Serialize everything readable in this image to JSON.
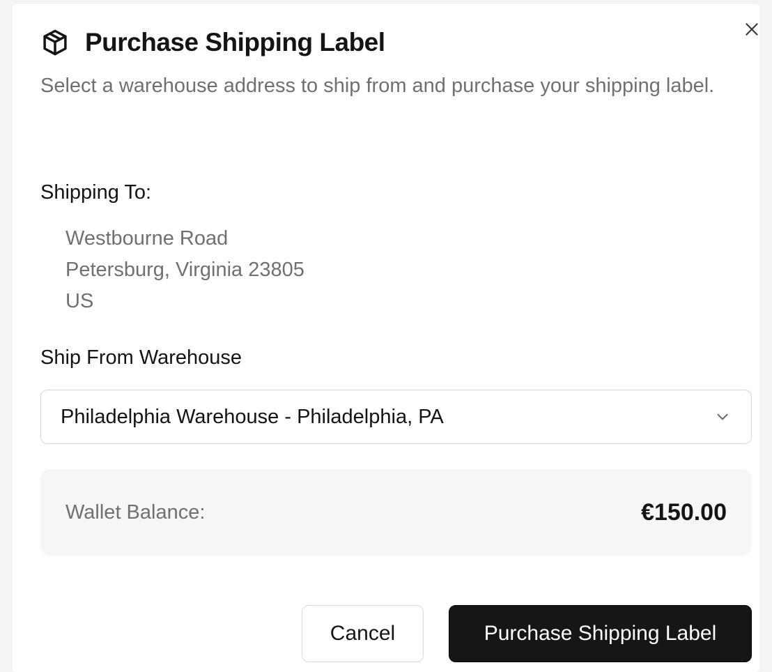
{
  "dialog": {
    "title": "Purchase Shipping Label",
    "title_icon": "package-icon",
    "close_icon": "close-icon",
    "subtitle": "Select a warehouse address to ship from and purchase your shipping label."
  },
  "shipping_to": {
    "label": "Shipping To:",
    "address_lines": [
      "Westbourne Road",
      "Petersburg, Virginia 23805",
      "US"
    ]
  },
  "ship_from": {
    "label": "Ship From Warehouse",
    "selected": "Philadelphia Warehouse - Philadelphia, PA",
    "chevron_icon": "chevron-down-icon"
  },
  "wallet": {
    "label": "Wallet Balance:",
    "amount": "€150.00"
  },
  "actions": {
    "cancel_label": "Cancel",
    "primary_label": "Purchase Shipping Label",
    "primary_color": "#161616"
  }
}
